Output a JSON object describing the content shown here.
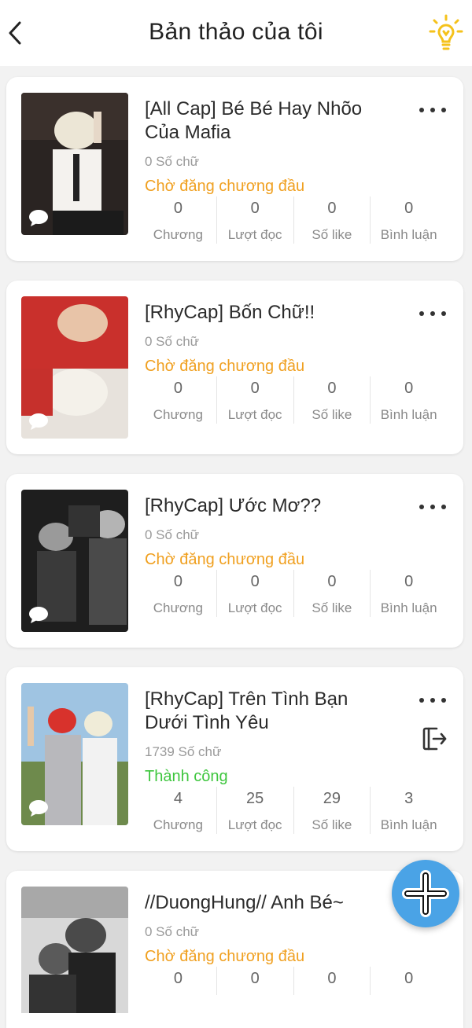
{
  "header": {
    "title": "Bản thảo của tôi",
    "back_icon": "chevron-left-icon",
    "hint_icon": "lightbulb-icon"
  },
  "colors": {
    "pending": "#f0a020",
    "success": "#3ec63e",
    "fab": "#4aa3e6",
    "bulb": "#f5c21b"
  },
  "stat_labels": [
    "Chương",
    "Lượt đọc",
    "Số like",
    "Bình luận"
  ],
  "stories": [
    {
      "title_line1": "[All Cap] Bé Bé Hay Nhõo",
      "title_line2": "Của Mafia",
      "word_count": "0 Số chữ",
      "status": "Chờ đăng chương đầu",
      "status_type": "pending",
      "stats": [
        "0",
        "0",
        "0",
        "0"
      ]
    },
    {
      "title_line1": "[RhyCap] Bốn Chữ!!",
      "title_line2": "",
      "word_count": "0 Số chữ",
      "status": "Chờ đăng chương đầu",
      "status_type": "pending",
      "stats": [
        "0",
        "0",
        "0",
        "0"
      ]
    },
    {
      "title_line1": "[RhyCap] Ước Mơ??",
      "title_line2": "",
      "word_count": "0 Số chữ",
      "status": "Chờ đăng chương đầu",
      "status_type": "pending",
      "stats": [
        "0",
        "0",
        "0",
        "0"
      ]
    },
    {
      "title_line1": "[RhyCap] Trên Tình Bạn",
      "title_line2": "Dưới Tình Yêu",
      "word_count": "1739 Số chữ",
      "status": "Thành công",
      "status_type": "success",
      "stats": [
        "4",
        "25",
        "29",
        "3"
      ]
    },
    {
      "title_line1": "//DuongHung// Anh Bé~",
      "title_line2": "",
      "word_count": "0 Số chữ",
      "status": "Chờ đăng chương đầu",
      "status_type": "pending",
      "stats": [
        "0",
        "0",
        "0",
        "0"
      ]
    }
  ],
  "fab_icon": "plus-icon"
}
